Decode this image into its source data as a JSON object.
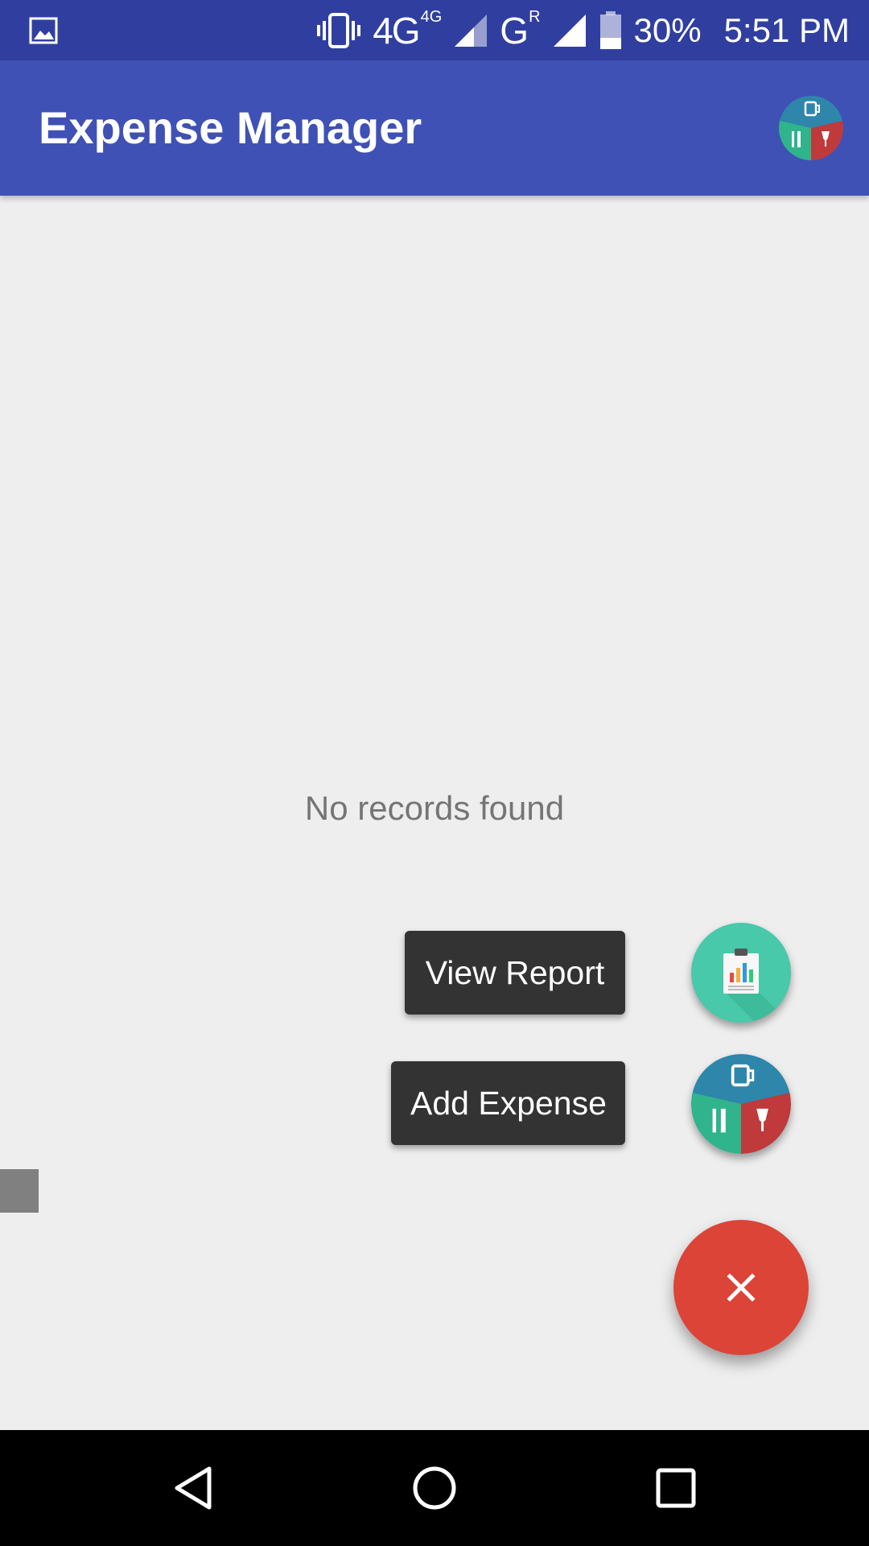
{
  "status_bar": {
    "network_1": "4G",
    "network_1_sup": "4G",
    "network_2": "G",
    "network_2_sup": "R",
    "battery": "30%",
    "time": "5:51 PM",
    "icons": [
      "image-notification-icon",
      "vibrate-icon",
      "signal-icon",
      "battery-icon"
    ]
  },
  "app_bar": {
    "title": "Expense Manager",
    "icon": "expense-category-icon"
  },
  "main": {
    "empty_message": "No records found"
  },
  "fab_menu": {
    "items": [
      {
        "label": "View Report",
        "icon": "report-clipboard-icon"
      },
      {
        "label": "Add Expense",
        "icon": "expense-category-icon"
      }
    ],
    "close_icon": "close-icon",
    "colors": {
      "primary": "#3f51b5",
      "primary_dark": "#303f9f",
      "accent": "#db4437",
      "report_teal": "#48c9a9"
    }
  },
  "nav_bar": {
    "icons": [
      "back-icon",
      "home-icon",
      "recents-icon"
    ]
  }
}
